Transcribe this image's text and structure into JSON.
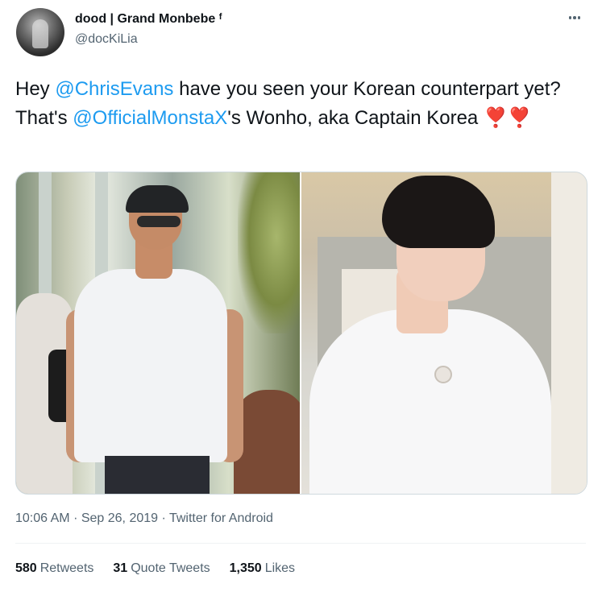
{
  "author": {
    "display_name": "dood | Grand Monbebe ᶠ",
    "handle": "@docKiLia",
    "avatar_icon": "avatar-photo"
  },
  "more_icon": "ellipsis-icon",
  "tweet": {
    "text_1": "Hey ",
    "mention_1": "@ChrisEvans",
    "text_2": " have you seen your Korean counterpart yet? That's ",
    "mention_2": "@OfficialMonstaX",
    "text_3": "'s Wonho, aka Captain Korea ",
    "emoji": "❣️❣️"
  },
  "media": {
    "photo_left": "man-in-cap-white-tshirt-photo",
    "photo_right": "man-white-tshirt-photo"
  },
  "meta": {
    "time": "10:06 AM",
    "separator": "·",
    "date": "Sep 26, 2019",
    "client": "Twitter for Android"
  },
  "stats": {
    "retweets_count": "580",
    "retweets_label": "Retweets",
    "quote_count": "31",
    "quote_label": "Quote Tweets",
    "likes_count": "1,350",
    "likes_label": "Likes"
  },
  "colors": {
    "link": "#1d9bf0",
    "secondary_text": "#536471",
    "heart": "#e0245e"
  }
}
